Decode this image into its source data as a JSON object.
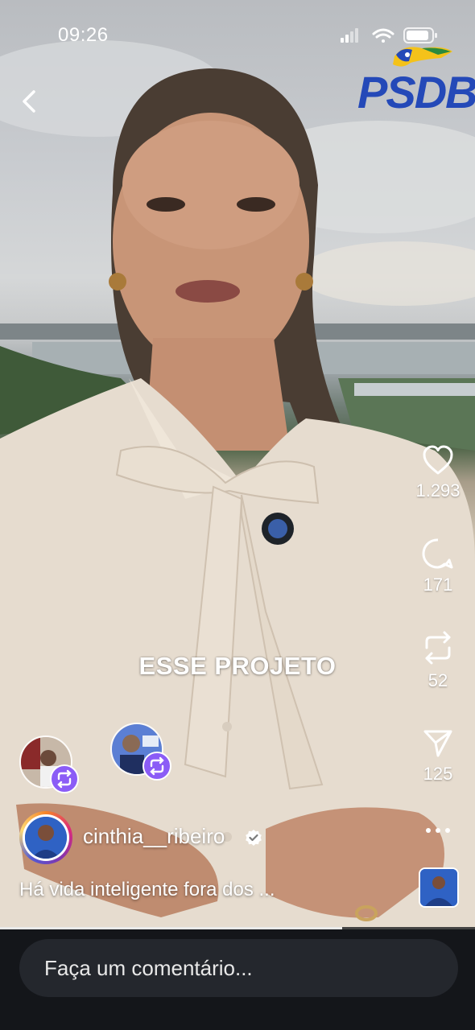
{
  "status_bar": {
    "time": "09:26"
  },
  "brand_logo": "PSDB",
  "video_caption": "ESSE PROJETO",
  "actions": {
    "like_count": "1.293",
    "comment_count": "171",
    "repost_count": "52",
    "share_count": "125"
  },
  "author": {
    "username": "cinthia__ribeiro",
    "verified": true,
    "description": "Há vida inteligente fora dos ..."
  },
  "comment_box": {
    "placeholder": "Faça um comentário..."
  },
  "icons": [
    "back-icon",
    "signal-icon",
    "wifi-icon",
    "battery-icon",
    "heart-icon",
    "comment-icon",
    "repost-icon",
    "share-icon",
    "more-icon",
    "verified-icon"
  ],
  "colors": {
    "logo_blue": "#2449b8",
    "repost_badge": "#8b5cf6",
    "bottom_bar": "#14161a"
  }
}
